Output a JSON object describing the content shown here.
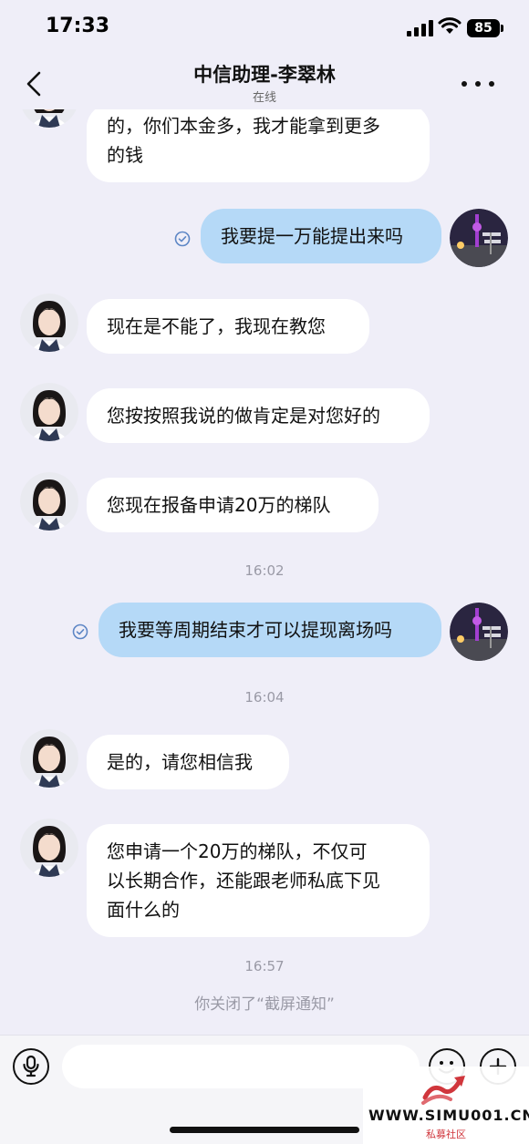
{
  "status_bar": {
    "time": "17:33",
    "battery": "85"
  },
  "header": {
    "title": "中信助理-李翠林",
    "status": "在线"
  },
  "messages": [
    {
      "side": "left",
      "lines": [
        "的，你们本金多，我才能拿到更多",
        "的钱"
      ]
    },
    {
      "side": "right",
      "text": "我要提一万能提出来吗",
      "read": true
    },
    {
      "side": "left",
      "text": "现在是不能了，我现在教您"
    },
    {
      "side": "left",
      "text": "您按按照我说的做肯定是对您好的"
    },
    {
      "side": "left",
      "text": "您现在报备申请20万的梯队"
    },
    {
      "time": "16:02"
    },
    {
      "side": "right",
      "text": "我要等周期结束才可以提现离场吗",
      "read": true
    },
    {
      "time": "16:04"
    },
    {
      "side": "left",
      "text": "是的，请您相信我"
    },
    {
      "side": "left",
      "lines": [
        "您申请一个20万的梯队，不仅可",
        "以长期合作，还能跟老师私底下见",
        "面什么的"
      ]
    },
    {
      "time": "16:57"
    },
    {
      "system": "你关闭了“截屏通知”"
    }
  ],
  "input": {
    "placeholder": ""
  },
  "watermark": {
    "url": "WWW.SIMU001.CN",
    "sub": "私募社区"
  },
  "icons": {
    "back": "chevron-left-icon",
    "more": "more-dots-icon",
    "read": "check-circle-icon",
    "voice": "microphone-icon",
    "emoji": "smiley-icon",
    "add": "plus-icon"
  },
  "colors": {
    "background": "#efeef8",
    "sent_bubble": "#b5d9f7",
    "received_bubble": "#ffffff",
    "muted_text": "#9a9aa6"
  }
}
